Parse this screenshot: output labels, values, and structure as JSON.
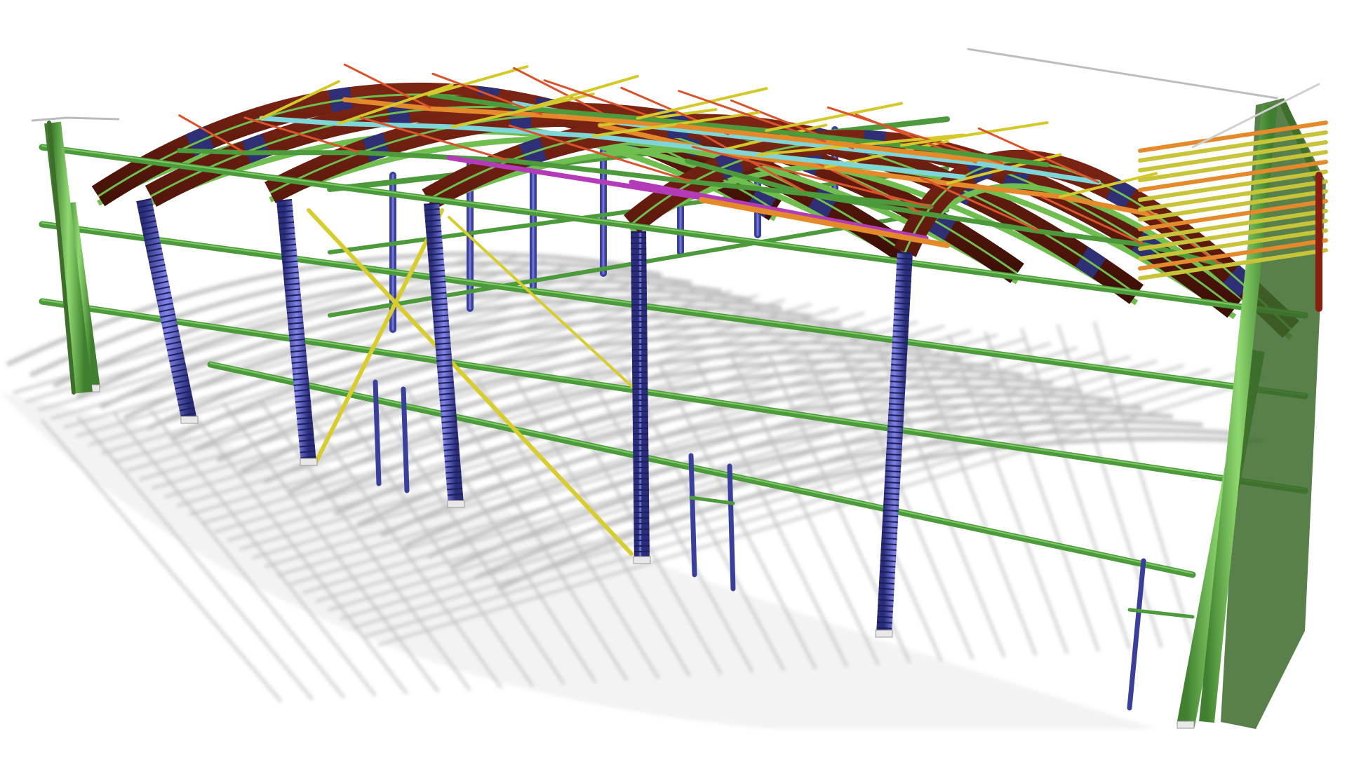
{
  "scene": {
    "background": "#ffffff",
    "member_colors": {
      "column_main": "#4f9a3c",
      "column_main_light": "#7ccb63",
      "column_secondary": "#3b3f9c",
      "column_secondary_light": "#6f74d8",
      "arch_chord": "#5a1a0e",
      "arch_splice": "#2e2f74",
      "arch_web": "#6fbe4f",
      "roof_bracing": "#d4c92a",
      "roof_bracing_red": "#d9532b",
      "purlin_orange": "#e58a2a",
      "purlin_magenta": "#b43bb8",
      "purlin_cyan": "#7fd6d8",
      "wall_girt": "#4c9a3c",
      "wall_bracing": "#d8cd2e",
      "gable_frame": "#3f6e2c",
      "shadow": "#8a8a8a"
    },
    "member_groups": [
      {
        "name": "main-columns",
        "icon": "column-icon"
      },
      {
        "name": "secondary-columns",
        "icon": "column-icon"
      },
      {
        "name": "arch-trusses",
        "icon": "arch-icon"
      },
      {
        "name": "roof-bracing",
        "icon": "bracing-icon"
      },
      {
        "name": "wall-girts",
        "icon": "girt-icon"
      },
      {
        "name": "wall-bracing",
        "icon": "bracing-icon"
      },
      {
        "name": "gable-frame",
        "icon": "frame-icon"
      },
      {
        "name": "ground-shadows",
        "icon": "shadow-icon"
      }
    ]
  }
}
